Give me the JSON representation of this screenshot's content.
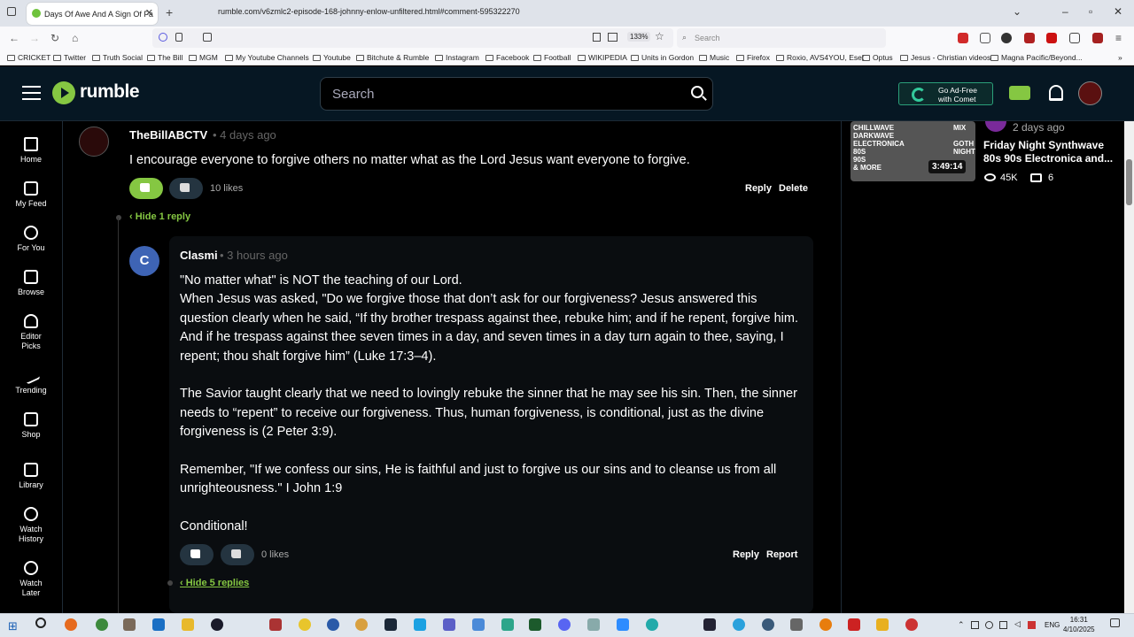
{
  "browser": {
    "tab_title": "Days Of Awe And A Sign Of Fa",
    "url": "rumble.com/v6zmlc2-episode-168-johnny-enlow-unfiltered.html#comment-595322270",
    "zoom": "133%",
    "search_placeholder": "Search",
    "bookmarks": [
      "CRICKET",
      "Twitter",
      "Truth Social",
      "The Bill",
      "MGM",
      "My Youtube Channels",
      "Youtube",
      "Bitchute & Rumble",
      "Instagram",
      "Facebook",
      "Football",
      "WIKIPEDIA",
      "Units in Gordon",
      "Music",
      "Firefox",
      "Roxio, AVS4YOU, Eset",
      "Optus",
      "Jesus - Christian videos",
      "Magna Pacific/Beyond..."
    ]
  },
  "header": {
    "logo": "rumble",
    "search_placeholder": "Search",
    "adfree": {
      "line1": "Go Ad-Free",
      "line2": "with Comet"
    }
  },
  "sidebar": [
    {
      "label": "Home"
    },
    {
      "label": "My Feed"
    },
    {
      "label": "For You"
    },
    {
      "label": "Browse"
    },
    {
      "label": "Editor\nPicks"
    },
    {
      "label": "Trending"
    },
    {
      "label": "Shop"
    },
    {
      "label": "Library"
    },
    {
      "label": "Watch\nHistory"
    },
    {
      "label": "Watch\nLater"
    }
  ],
  "comments": {
    "parent": {
      "author": "TheBillABCTV",
      "time": "4 days ago",
      "text": "I encourage everyone to forgive others no matter what as the Lord Jesus want everyone to forgive.",
      "likes": "10 likes",
      "reply": "Reply",
      "delete": "Delete",
      "toggle": "‹ Hide 1 reply"
    },
    "reply": {
      "avatar_letter": "C",
      "author": "Clasmi",
      "time": "3 hours ago",
      "text": "\"No matter what\" is NOT the teaching of our Lord.\nWhen Jesus was asked, \"Do we forgive those that don’t ask for our forgiveness? Jesus answered this question clearly when he said, “If thy brother trespass against thee, rebuke him; and if he repent, forgive him. And if he trespass against thee seven times in a day, and seven times in a day turn again to thee, saying, I repent; thou shalt forgive him” (Luke 17:3–4).\n\nThe Savior taught clearly that we need to lovingly rebuke the sinner that he may see his sin. Then, the sinner needs to “repent” to receive our forgiveness. Thus, human forgiveness, is conditional, just as the divine forgiveness is (2 Peter 3:9).\n\nRemember, \"If we confess our sins, He is faithful and just to forgive us our sins and to cleanse us from all unrighteousness.\" I John 1:9\n\nConditional!",
      "likes": "0 likes",
      "reply": "Reply",
      "report": "Report",
      "toggle": "‹ Hide 5 replies"
    }
  },
  "related_video": {
    "thumb_text_left": "CHILLWAVE\nDARKWAVE\nELECTRONICA\n80S\n90S\n& MORE",
    "thumb_text_right": "MIX\n\nGOTH\nNIGHT",
    "duration": "3:49:14",
    "time": "2 days ago",
    "title": "Friday Night Synthwave 80s 90s Electronica and...",
    "views": "45K",
    "comments": "6"
  },
  "taskbar": {
    "lang": "ENG",
    "time": "16:31",
    "date": "4/10/2025"
  }
}
